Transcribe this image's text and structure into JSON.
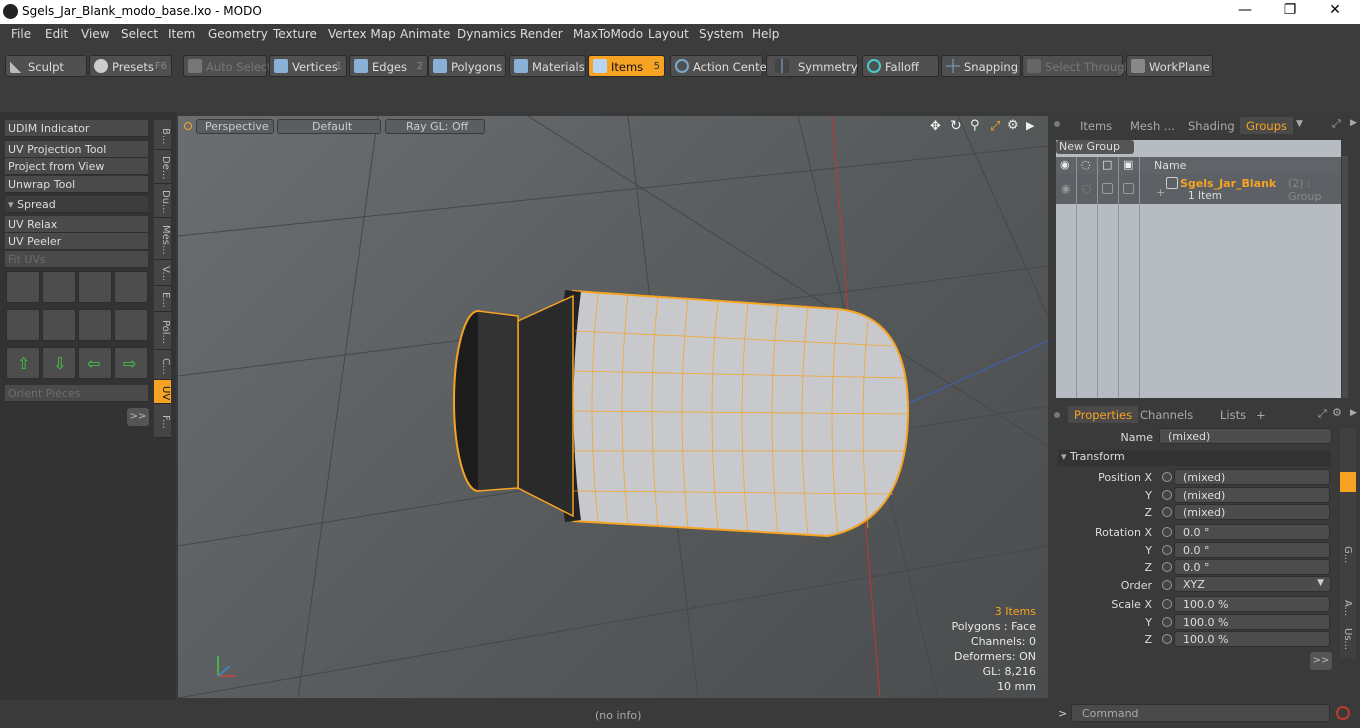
{
  "window": {
    "title": "Sgels_Jar_Blank_modo_base.lxo - MODO",
    "minimize": "—",
    "maximize": "❐",
    "close": "✕"
  },
  "menu": [
    "File",
    "Edit",
    "View",
    "Select",
    "Item",
    "Geometry",
    "Texture",
    "Vertex Map",
    "Animate",
    "Dynamics",
    "Render",
    "MaxToModo",
    "Layout",
    "System",
    "Help"
  ],
  "toolbar": {
    "sculpt": "Sculpt",
    "presets": "Presets",
    "presets_key": "F6",
    "auto_select": "Auto Select",
    "vertices": "Vertices",
    "vertices_num": "1",
    "edges": "Edges",
    "edges_num": "2",
    "polygons": "Polygons",
    "materials": "Materials",
    "items": "Items",
    "items_num": "5",
    "action_center": "Action Center",
    "symmetry": "Symmetry",
    "falloff": "Falloff",
    "snapping": "Snapping",
    "select_through": "Select Through",
    "workplane": "WorkPlane"
  },
  "left": {
    "buttons": [
      "UDIM Indicator",
      "UV Projection Tool",
      "Project from View",
      "Unwrap Tool"
    ],
    "spread": "Spread",
    "buttons2": [
      "UV Relax",
      "UV Peeler"
    ],
    "fit_uvs": "Fit UVs",
    "orient": "Orient Pieces",
    "more": ">>",
    "vtabs": [
      "B...",
      "De...",
      "Du...",
      "Mes...",
      "V...",
      "E...",
      "Pol...",
      "C...",
      "UV",
      "F..."
    ]
  },
  "viewport": {
    "view": "Perspective",
    "shading": "Default",
    "raygl": "Ray GL: Off",
    "stats": {
      "items": "3 Items",
      "polygons": "Polygons : Face",
      "channels": "Channels: 0",
      "deformers": "Deformers: ON",
      "gl": "GL: 8,216",
      "unit": "10 mm"
    }
  },
  "groups": {
    "tabs": [
      "Items",
      "Mesh ...",
      "Shading",
      "Groups"
    ],
    "new_group": "New Group",
    "name_header": "Name",
    "item_name": "Sgels_Jar_Blank",
    "item_suffix": "(2) : Group",
    "item_sub": "1 Item"
  },
  "properties": {
    "tabs": [
      "Properties",
      "Channels",
      "Lists",
      "+"
    ],
    "name_label": "Name",
    "name_value": "(mixed)",
    "transform": "Transform",
    "position_x_label": "Position X",
    "position_x": "(mixed)",
    "position_y_label": "Y",
    "position_y": "(mixed)",
    "position_z_label": "Z",
    "position_z": "(mixed)",
    "rotation_x_label": "Rotation X",
    "rotation_x": "0.0 °",
    "rotation_y_label": "Y",
    "rotation_y": "0.0 °",
    "rotation_z_label": "Z",
    "rotation_z": "0.0 °",
    "order_label": "Order",
    "order": "XYZ",
    "scale_x_label": "Scale X",
    "scale_x": "100.0 %",
    "scale_y_label": "Y",
    "scale_y": "100.0 %",
    "scale_z_label": "Z",
    "scale_z": "100.0 %",
    "more": ">>",
    "side_tabs": [
      "G...",
      "A...",
      "Us..."
    ]
  },
  "status": {
    "info": "(no info)",
    "prompt": ">",
    "command_placeholder": "Command"
  },
  "colors": {
    "accent": "#f6a323",
    "panel": "#3a3a3a",
    "viewport": "#5a5d60"
  }
}
